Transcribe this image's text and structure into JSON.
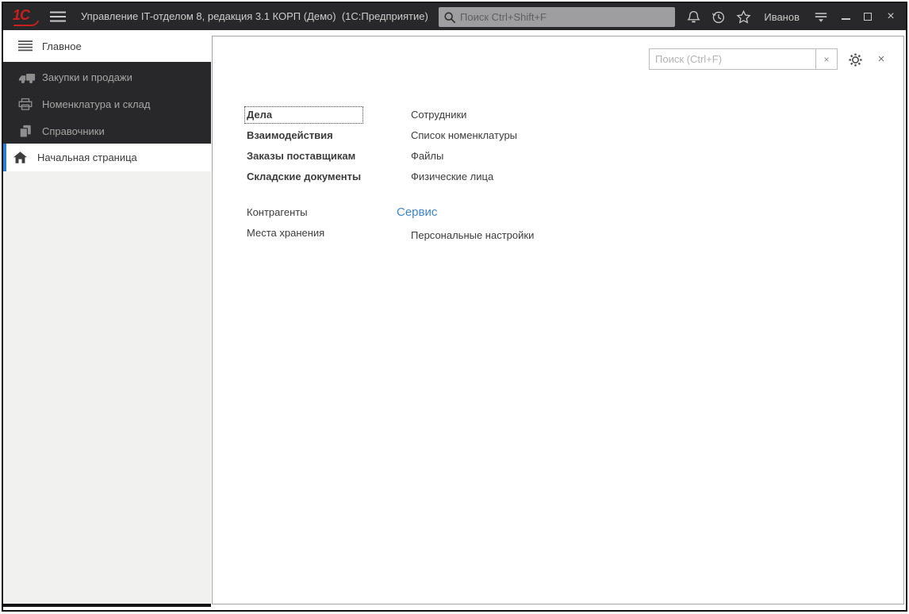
{
  "titlebar": {
    "logo_text": "1С",
    "app_title": "Управление IT-отделом 8, редакция 3.1 КОРП (Демо)  (1С:Предприятие)",
    "search_placeholder": "Поиск Ctrl+Shift+F",
    "user_name": "Иванов",
    "close_glyph": "×"
  },
  "sidebar": {
    "items": [
      {
        "label": "Главное",
        "icon": "list-icon",
        "active": true
      },
      {
        "label": "Закупки и продажи",
        "icon": "truck-icon",
        "active": false
      },
      {
        "label": "Номенклатура и склад",
        "icon": "printer-icon",
        "active": false
      },
      {
        "label": "Справочники",
        "icon": "documents-icon",
        "active": false
      },
      {
        "label": "Начальная страница",
        "icon": "home-icon",
        "active": true
      }
    ]
  },
  "panel": {
    "search_placeholder": "Поиск (Ctrl+F)",
    "clear_glyph": "×",
    "close_glyph": "×",
    "links_bold": [
      "Дела",
      "Взаимодействия",
      "Заказы поставщикам",
      "Складские документы"
    ],
    "links_col2": [
      "Сотрудники",
      "Список номенклатуры",
      "Файлы",
      "Физические лица"
    ],
    "links_col1_extra": [
      "Контрагенты",
      "Места хранения"
    ],
    "service_header": "Сервис",
    "service_items": [
      "Персональные настройки"
    ],
    "focused_link": "Дела"
  },
  "colors": {
    "titlebar_bg": "#28282a",
    "sidebar_bg": "#28282a",
    "sidebar_lower_bg": "#f1f1f0",
    "accent_blue": "#2b7cd3",
    "service_link_blue": "#3d87c8",
    "logo_red": "#c9201d",
    "panel_border": "#a5a5a5"
  }
}
